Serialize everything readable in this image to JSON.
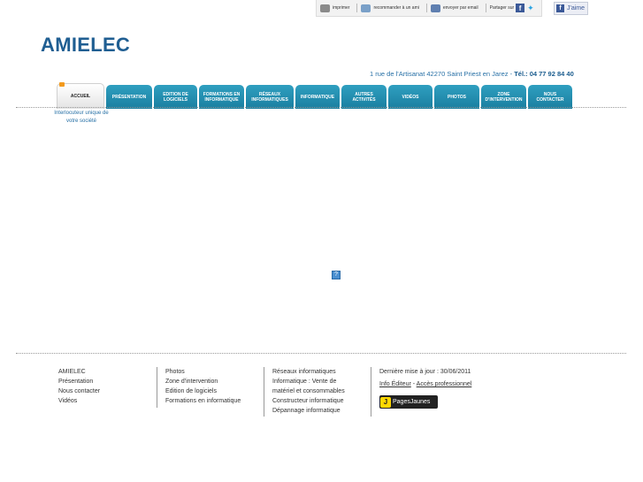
{
  "sharebar": {
    "print_label": "imprimer",
    "recommend_label": "recommander à un ami",
    "email_label": "envoyer par email",
    "share_label": "Partager sur",
    "like_label": "J'aime"
  },
  "header": {
    "site_title": "AMIELEC",
    "address": "1 rue de l'Artisanat 42270 Saint Priest en Jarez  -",
    "phone": "Tél.: 04 77 92 84 40"
  },
  "nav": {
    "tabs": [
      {
        "label": "ACCUEIL",
        "active": true
      },
      {
        "label": "PRÉSENTATION"
      },
      {
        "label": "EDITION DE LOGICIELS"
      },
      {
        "label": "FORMATIONS EN INFORMATIQUE"
      },
      {
        "label": "RÉSEAUX INFORMATIQUES"
      },
      {
        "label": "INFORMATIQUE"
      },
      {
        "label": "AUTRES ACTIVITÉS"
      },
      {
        "label": "VIDÉOS"
      },
      {
        "label": "PHOTOS"
      },
      {
        "label": "ZONE D'INTERVENTION"
      },
      {
        "label": "NOUS CONTACTER"
      }
    ],
    "tagline": "Interlocuteur unique de votre société"
  },
  "main": {
    "plugin_icon": "question-mark-icon"
  },
  "footer": {
    "col1": [
      "AMIELEC",
      "Présentation",
      "Nous contacter",
      "Vidéos"
    ],
    "col2": [
      "Photos",
      "Zone d'intervention",
      "Edition de logiciels",
      "Formations en informatique"
    ],
    "col3": [
      "Réseaux informatiques",
      "Informatique : Vente de",
      "matériel et consommables",
      "Constructeur informatique",
      "Dépannage informatique"
    ],
    "last_update": "Dernière mise à jour : 30/06/2011",
    "info_editor": "Info Éditeur",
    "dash": "-",
    "pro_access": "Accès professionnel",
    "pagesjaunes": "PagesJaunes"
  },
  "colors": {
    "brand": "#1f5e92",
    "tab": "#2a9abc"
  }
}
